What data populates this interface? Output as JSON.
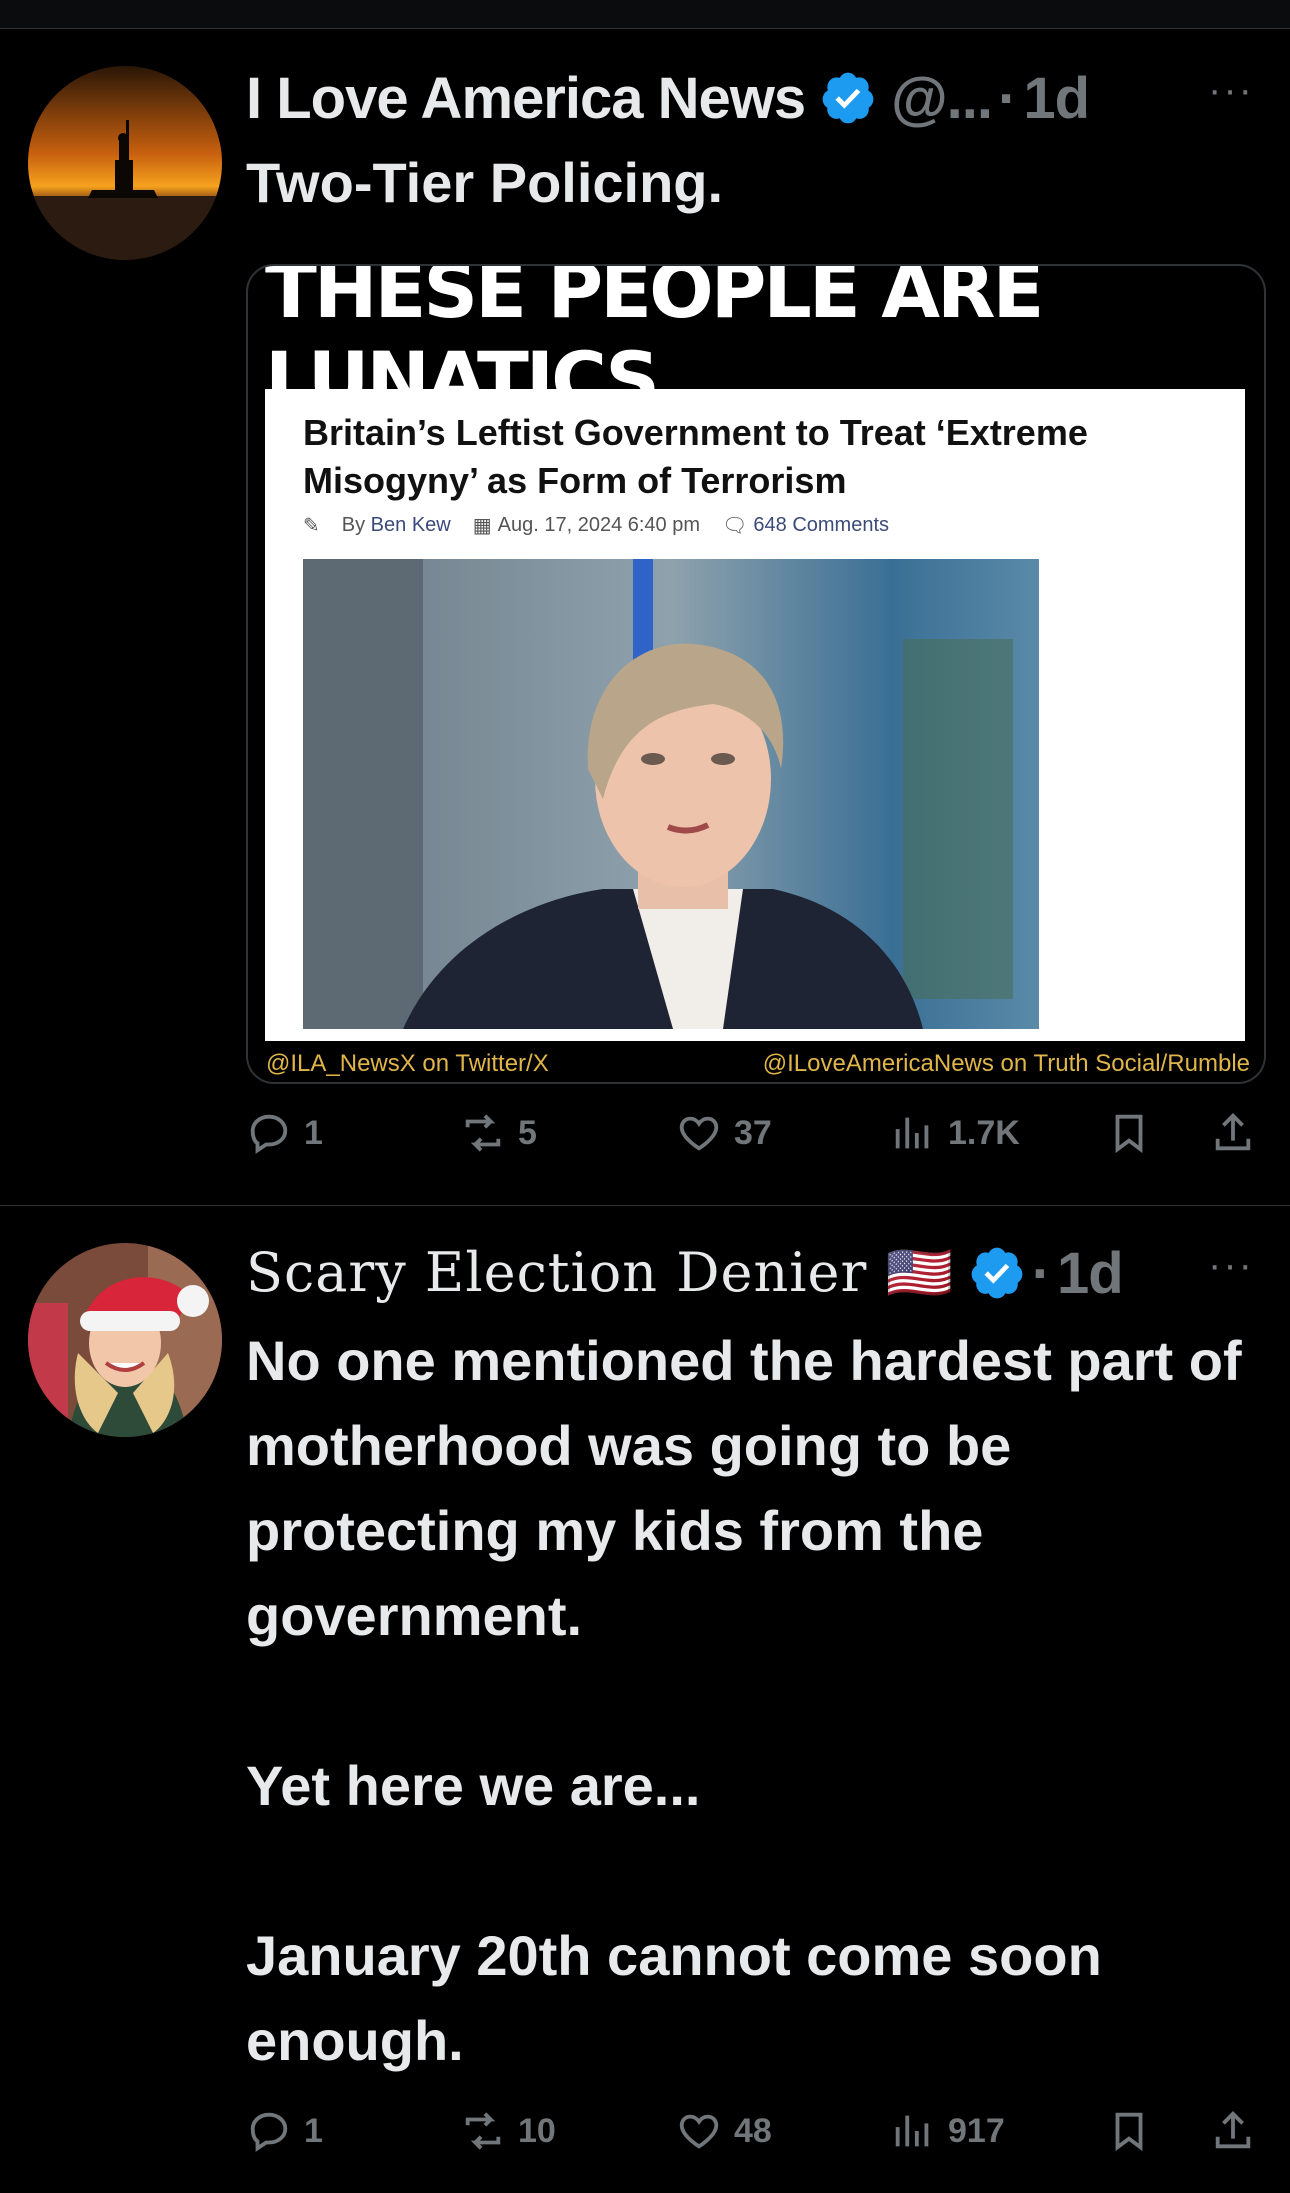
{
  "tweets": [
    {
      "author": "I Love America News",
      "handle": "@...",
      "time": "1d",
      "text": "Two-Tier Policing.",
      "media": {
        "banner": "THESE PEOPLE ARE LUNATICS",
        "headline": "Britain’s Leftist Government to Treat ‘Extreme Misogyny’ as Form of Terrorism",
        "byline_prefix": "By",
        "author": "Ben Kew",
        "date": "Aug. 17, 2024 6:40 pm",
        "comments": "648 Comments",
        "caption_left": "@ILA_NewsX on Twitter/X",
        "caption_right": "@ILoveAmericaNews on Truth Social/Rumble"
      },
      "stats": {
        "replies": "1",
        "reposts": "5",
        "likes": "37",
        "views": "1.7K"
      }
    },
    {
      "author": "Scary Election Denier 🇺🇸",
      "time": "1d",
      "text": "No one mentioned the hardest part of motherhood was going to be protecting my kids from the government.\n\nYet here we are...\n\nJanuary 20th cannot come soon enough.",
      "stats": {
        "replies": "1",
        "reposts": "10",
        "likes": "48",
        "views": "917"
      }
    }
  ],
  "ui": {
    "more": "···",
    "separator": "·"
  },
  "colors": {
    "verified": "#1d9bf0",
    "muted": "#71767b",
    "caption": "#e0b64a"
  }
}
